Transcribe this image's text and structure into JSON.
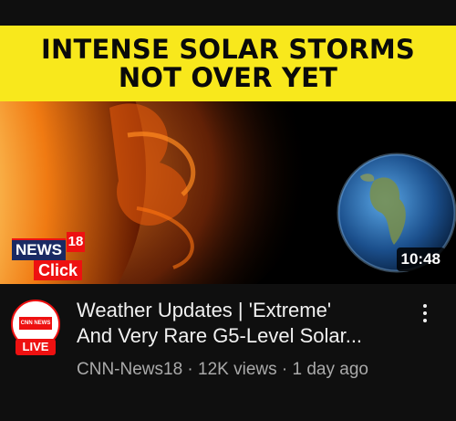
{
  "thumbnail": {
    "headline_line1": "INTENSE SOLAR STORMS",
    "headline_line2": "NOT OVER YET",
    "brand_news": "NEWS",
    "brand_number": "18",
    "brand_click": "Click",
    "duration": "10:48"
  },
  "video": {
    "title_line1": "Weather Updates | 'Extreme'",
    "title_line2": "And Very Rare G5-Level Solar...",
    "meta": "CNN-News18 · 12K views · 1 day ago",
    "live_badge": "LIVE",
    "channel_avatar_text": "CNN NEWS 18"
  },
  "colors": {
    "banner": "#f8e81c",
    "live_red": "#e11111",
    "background": "#0f0f0f"
  }
}
